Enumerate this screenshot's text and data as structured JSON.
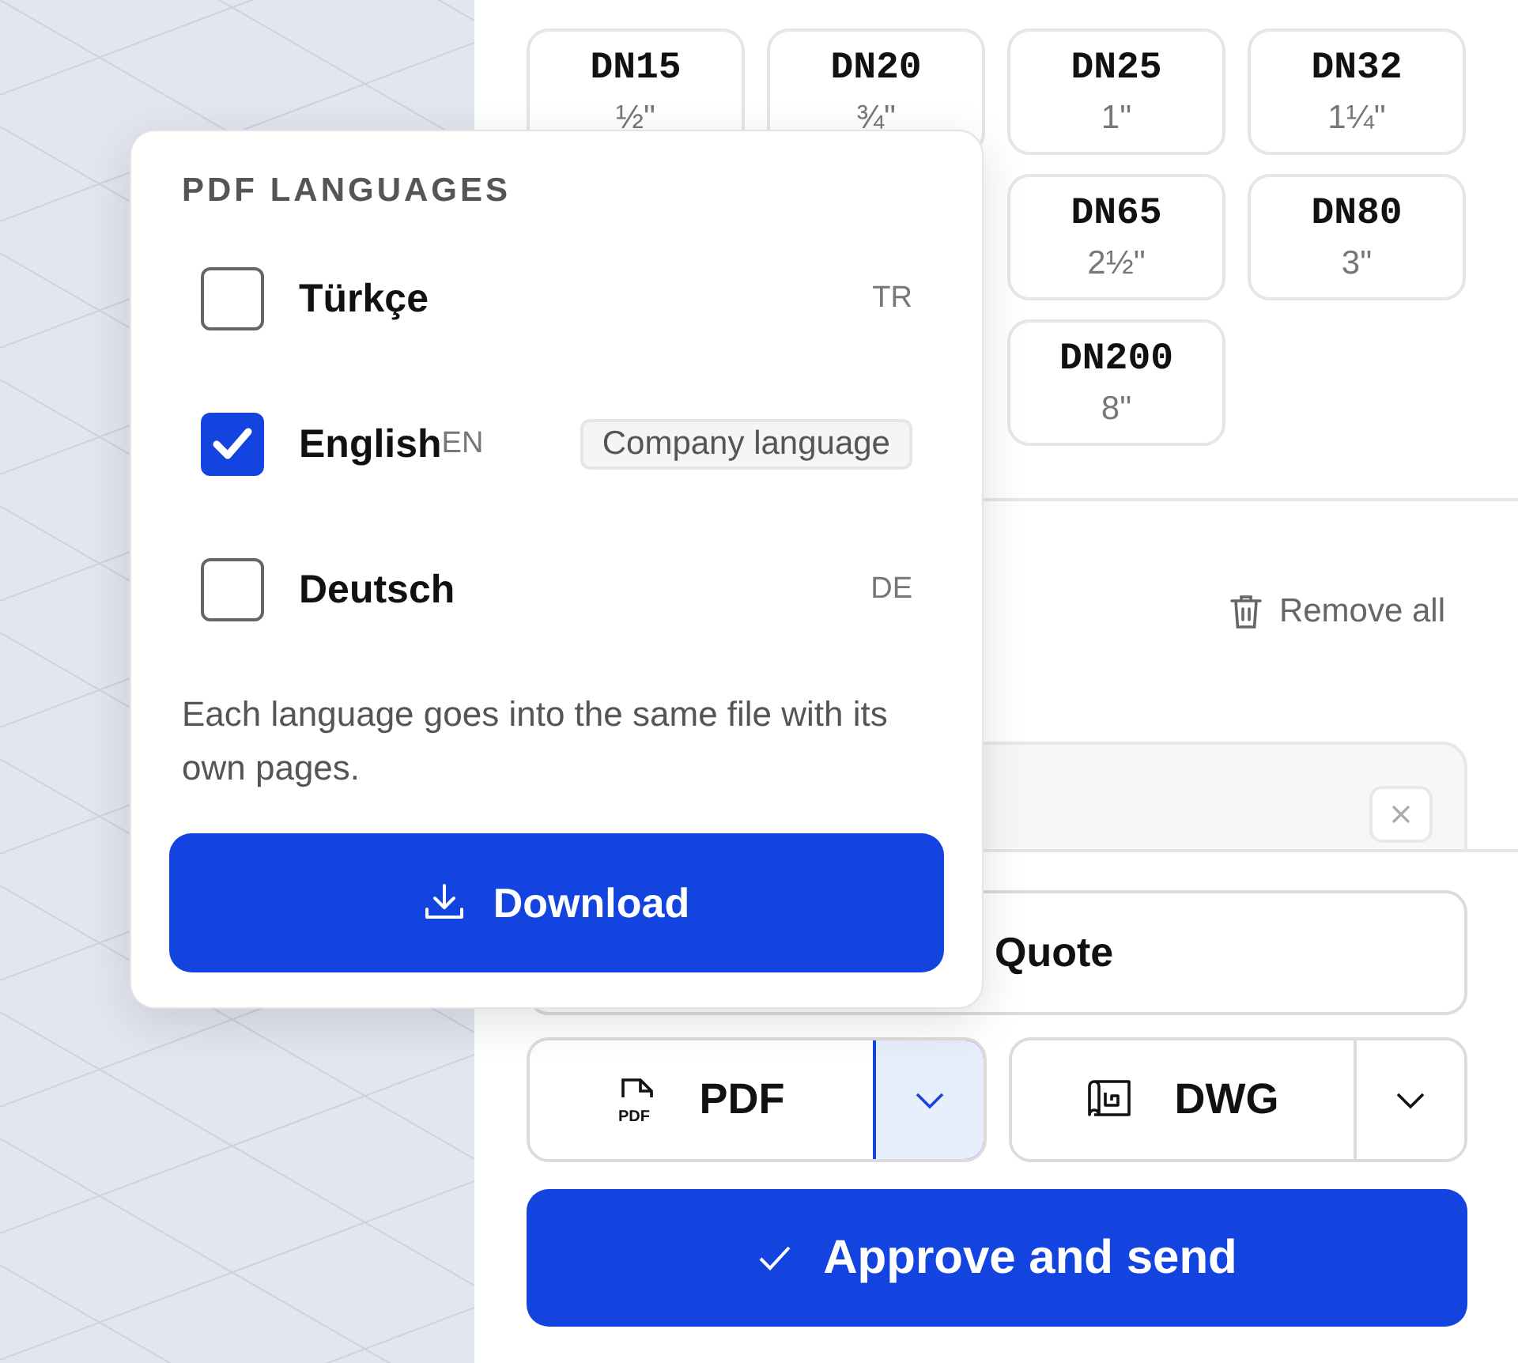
{
  "sizes": [
    {
      "label": "DN15",
      "inch": "½\""
    },
    {
      "label": "DN20",
      "inch": "¾\""
    },
    {
      "label": "DN25",
      "inch": "1\""
    },
    {
      "label": "DN32",
      "inch": "1¼\""
    },
    {
      "label": "DN65",
      "inch": "2½\""
    },
    {
      "label": "DN80",
      "inch": "3\""
    },
    {
      "label": "DN200",
      "inch": "8\""
    }
  ],
  "languages_popover": {
    "title": "PDF LANGUAGES",
    "languages": [
      {
        "name": "Türkçe",
        "code": "TR",
        "checked": false
      },
      {
        "name": "English",
        "code": "EN",
        "checked": true,
        "badge": "Company language"
      },
      {
        "name": "Deutsch",
        "code": "DE",
        "checked": false
      }
    ],
    "note": "Each language goes into the same file with its own pages.",
    "download_button": "Download"
  },
  "remove_all_button": "Remove all",
  "quote_button": "Quote",
  "exports": [
    {
      "label": "PDF",
      "kind": "pdf",
      "icon_text": "PDF",
      "menu_open": true
    },
    {
      "label": "DWG",
      "kind": "dwg",
      "menu_open": false
    }
  ],
  "approve_button": "Approve and send"
}
